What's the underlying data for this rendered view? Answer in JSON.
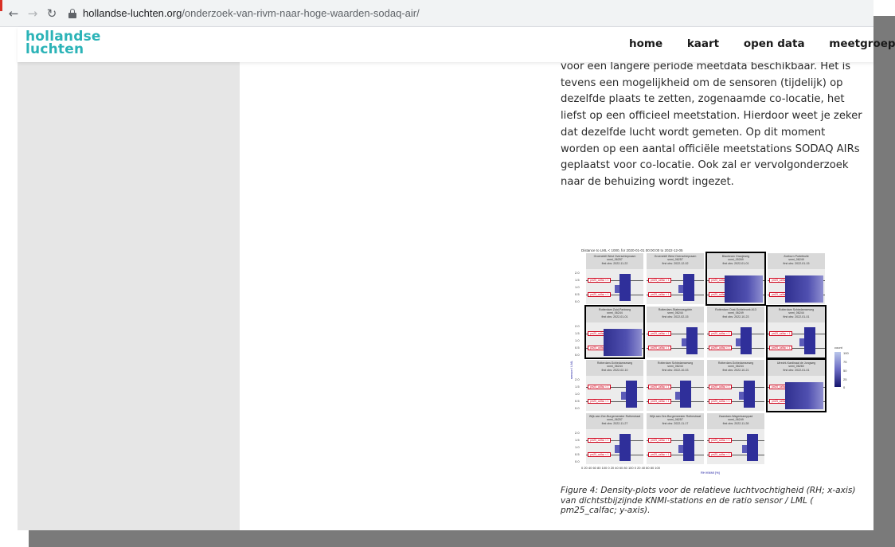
{
  "browser": {
    "url_host": "hollandse-luchten.org",
    "url_path": "/onderzoek-van-rivm-naar-hoge-waarden-sodaq-air/"
  },
  "site": {
    "logo_line1": "hollandse",
    "logo_line2": "luchten",
    "nav": [
      "home",
      "kaart",
      "open data",
      "meetgroepen"
    ],
    "brand_color": "#2bb3b7"
  },
  "article": {
    "text": "voor een langere periode meetdata beschikbaar. Het is tevens een mogelijkheid om de sensoren (tijdelijk) op dezelfde plaats te zetten, zogenaamde co-locatie, het liefst op een officieel meetstation. Hierdoor weet je zeker dat dezelfde lucht wordt gemeten.  Op dit moment worden op een aantal officiële meetstations SODAQ AIRs geplaatst voor co-locatie. Ook zal er vervolgonderzoek naar de behuizing wordt ingezet."
  },
  "figure": {
    "title": "Distance to LML < 1000, for 2020-01-01 00:00:00 to 2022-12-05",
    "tag_label": "pm25_calfac < 1",
    "y_ticks": [
      "2.0",
      "1.5",
      "1.0",
      "0.5",
      "0.0"
    ],
    "y_label": "sensor / LML",
    "x_ticks": "0  20  40  60  80  100 0  20  40  60  80  100 0  20  40  60  80  100",
    "x_label": "RH KNMI [%]",
    "legend_title": "count",
    "legend_values": [
      "100",
      "75",
      "50",
      "25",
      "0"
    ],
    "panels": [
      {
        "name": "Groenekill West Overschiepraam",
        "id": "snmi_06257",
        "date": "first obs: 2022-11-22"
      },
      {
        "name": "Groenekill West Overschiepraam",
        "id": "snmi_06257",
        "date": "first obs: 2022-12-02"
      },
      {
        "name": "Blaubeam Oranjeweg",
        "id": "snmi_05269",
        "date": "first obs: 2022-01-01"
      },
      {
        "name": "Zoeburn Portefeuile",
        "id": "snmi_06249",
        "date": "first obs: 2022-01-15"
      },
      {
        "name": "Rotterdam Zuid-Parkweg",
        "id": "snmi_06244",
        "date": "first obs: 2022-01-01"
      },
      {
        "name": "Rotterdam-Statenwegplein",
        "id": "snmi_06244",
        "date": "first obs: 2022-02-15"
      },
      {
        "name": "Rotterdam Oost-Schiebroek A13",
        "id": "snmi_06249",
        "date": "first obs: 2022-10-23"
      },
      {
        "name": "Rotterdam Schiedamseweg",
        "id": "snmi_06244",
        "date": "first obs: 2022-01-01"
      },
      {
        "name": "Rotterdam-Schiedamseweg",
        "id": "snmi_06244",
        "date": "first obs: 2022-02-10"
      },
      {
        "name": "Rotterdam Schiedamseweg",
        "id": "snmi_06244",
        "date": "first obs: 2022-10-03"
      },
      {
        "name": "Rotterdam-Schiedamseweg",
        "id": "snmi_06244",
        "date": "first obs: 2022-10-21"
      },
      {
        "name": "Utrecht-Kardinaal de Jongweg",
        "id": "snmi_06260",
        "date": "first obs: 2022-01-01"
      },
      {
        "name": "Wijk aan Zee-Burgemeester Rothestraat",
        "id": "snmi_06257",
        "date": "first obs: 2022-11-27"
      },
      {
        "name": "Wijk aan Zee-Burgemeester Rothestraat",
        "id": "snmi_06257",
        "date": "first obs: 2022-11-17"
      },
      {
        "name": "Zaandam-Wagenkamppad",
        "id": "snmi_06249",
        "date": "first obs: 2022-11-28"
      }
    ],
    "caption": "Figure 4: Density-plots voor de relatieve luchtvochtigheid (RH; x-axis) van dichtstbijzijnde KNMI-stations en de ratio sensor / LML ( pm25_calfac; y-axis)."
  }
}
